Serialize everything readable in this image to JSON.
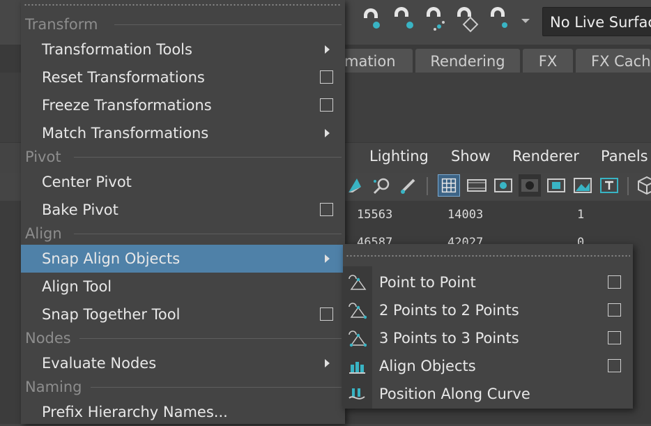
{
  "colors": {
    "menu_bg": "#444444",
    "highlight": "#4f81a8",
    "section_text": "#8d8d8d",
    "accent_icon": "#39b4c4"
  },
  "background": {
    "live_surface": "No Live Surface",
    "tabs": [
      "mation",
      "Rendering",
      "FX",
      "FX Cach"
    ],
    "viewport_menus": [
      "Lighting",
      "Show",
      "Renderer",
      "Panels"
    ],
    "table_rows": [
      [
        "15563",
        "14003",
        "1"
      ],
      [
        "46587",
        "42027",
        "0"
      ]
    ]
  },
  "menu": {
    "sections": {
      "transform": "Transform",
      "pivot": "Pivot",
      "align": "Align",
      "nodes": "Nodes",
      "naming": "Naming"
    },
    "items": {
      "transformation_tools": "Transformation Tools",
      "reset_transformations": "Reset Transformations",
      "freeze_transformations": "Freeze Transformations",
      "match_transformations": "Match Transformations",
      "center_pivot": "Center Pivot",
      "bake_pivot": "Bake Pivot",
      "snap_align_objects": "Snap Align Objects",
      "align_tool": "Align Tool",
      "snap_together_tool": "Snap Together Tool",
      "evaluate_nodes": "Evaluate Nodes",
      "prefix_hierarchy_names": "Prefix Hierarchy Names..."
    }
  },
  "submenu": {
    "items": {
      "point_to_point": "Point to Point",
      "two_points": "2 Points to 2 Points",
      "three_points": "3 Points to 3 Points",
      "align_objects": "Align Objects",
      "position_along_curve": "Position Along Curve"
    },
    "icons": [
      "point-to-point-icon",
      "two-points-icon",
      "three-points-icon",
      "align-objects-icon",
      "position-along-curve-icon"
    ]
  }
}
